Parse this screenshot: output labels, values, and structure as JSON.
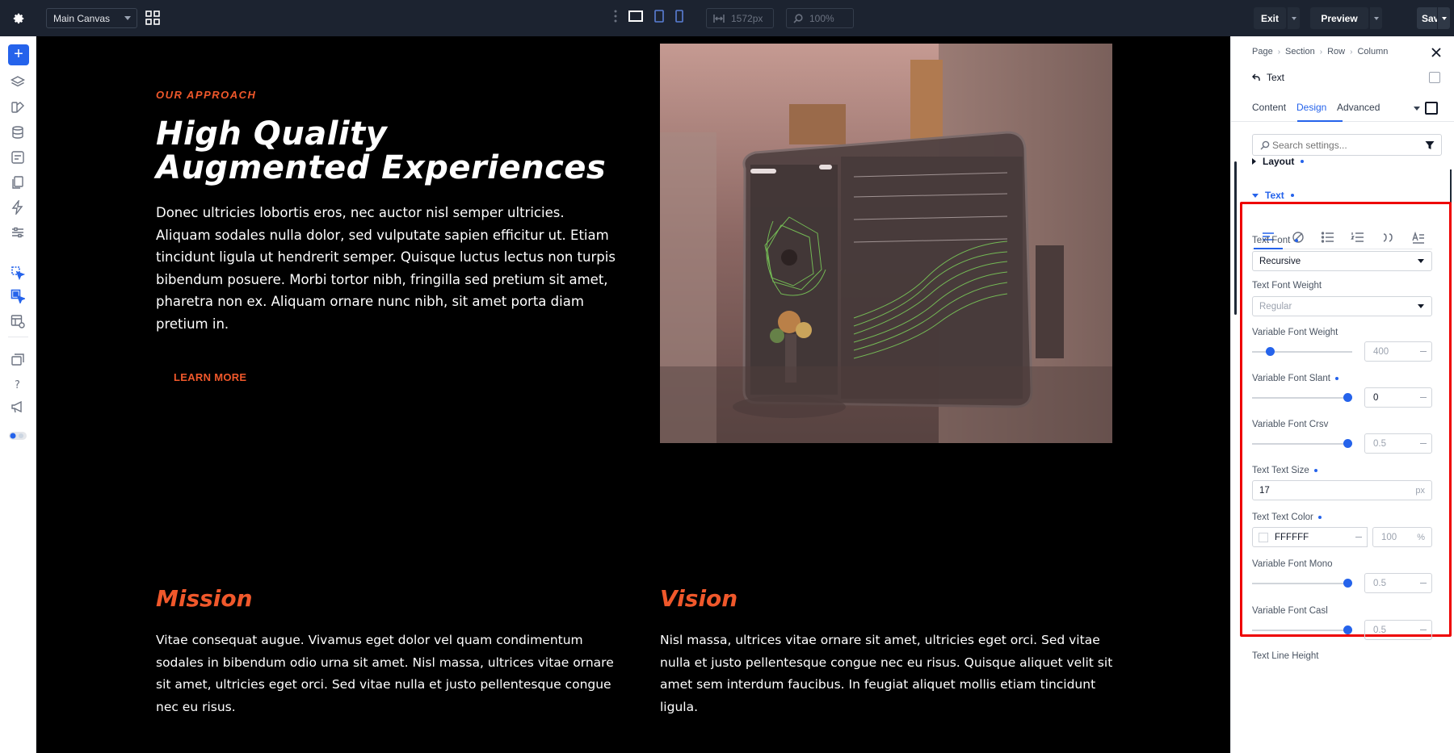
{
  "topbar": {
    "canvas_name": "Main Canvas",
    "width_value": "1572px",
    "zoom_value": "100%",
    "exit_label": "Exit",
    "preview_label": "Preview",
    "save_label": "Save"
  },
  "canvas": {
    "eyebrow": "OUR APPROACH",
    "hero_title": "High Quality Augmented Experiences",
    "hero_body": "Donec ultricies lobortis eros, nec auctor nisl semper ultricies. Aliquam sodales nulla dolor, sed vulputate sapien efficitur ut. Etiam tincidunt ligula ut hendrerit semper. Quisque luctus lectus non turpis bibendum posuere. Morbi tortor nibh, fringilla sed pretium sit amet, pharetra non ex. Aliquam ornare nunc nibh, sit amet porta diam pretium in.",
    "cta_label": "LEARN MORE",
    "mission_title": "Mission",
    "mission_body": "Vitae consequat augue. Vivamus eget dolor vel quam condimentum sodales in bibendum odio urna sit amet. Nisl massa, ultrices vitae ornare sit amet, ultricies eget orci. Sed vitae nulla et justo pellentesque congue nec eu risus.",
    "vision_title": "Vision",
    "vision_body": "Nisl massa, ultrices vitae ornare sit amet, ultricies eget orci. Sed vitae nulla et justo pellentesque congue nec eu risus. Quisque aliquet velit sit amet sem interdum faucibus. In feugiat aliquet mollis etiam tincidunt ligula."
  },
  "panel": {
    "breadcrumbs": [
      "Page",
      "Section",
      "Row",
      "Column"
    ],
    "element_name": "Text",
    "tabs": [
      "Content",
      "Design",
      "Advanced"
    ],
    "active_tab": "Design",
    "search_placeholder": "Search settings...",
    "sections": {
      "layout": "Layout",
      "text": "Text"
    },
    "fields": {
      "text_font_label": "Text Font",
      "text_font_value": "Recursive",
      "text_font_weight_label": "Text Font Weight",
      "text_font_weight_value": "Regular",
      "var_weight_label": "Variable Font Weight",
      "var_weight_value": "400",
      "var_slant_label": "Variable Font Slant",
      "var_slant_value": "0",
      "var_crsv_label": "Variable Font Crsv",
      "var_crsv_value": "0.5",
      "text_size_label": "Text Text Size",
      "text_size_value": "17",
      "text_size_unit": "px",
      "text_color_label": "Text Text Color",
      "text_color_value": "FFFFFF",
      "text_color_alpha": "100",
      "text_color_alpha_unit": "%",
      "var_mono_label": "Variable Font Mono",
      "var_mono_value": "0.5",
      "var_casl_label": "Variable Font Casl",
      "var_casl_value": "0.5",
      "line_height_label": "Text Line Height"
    },
    "sliders": {
      "var_weight": 0.15,
      "var_slant": 1.0,
      "var_crsv": 1.0,
      "var_mono": 1.0,
      "var_casl": 1.0
    }
  },
  "colors": {
    "accent": "#2563eb",
    "brand_orange": "#f0582b",
    "topbar_bg": "#1c2330",
    "highlight": "#e00000"
  }
}
